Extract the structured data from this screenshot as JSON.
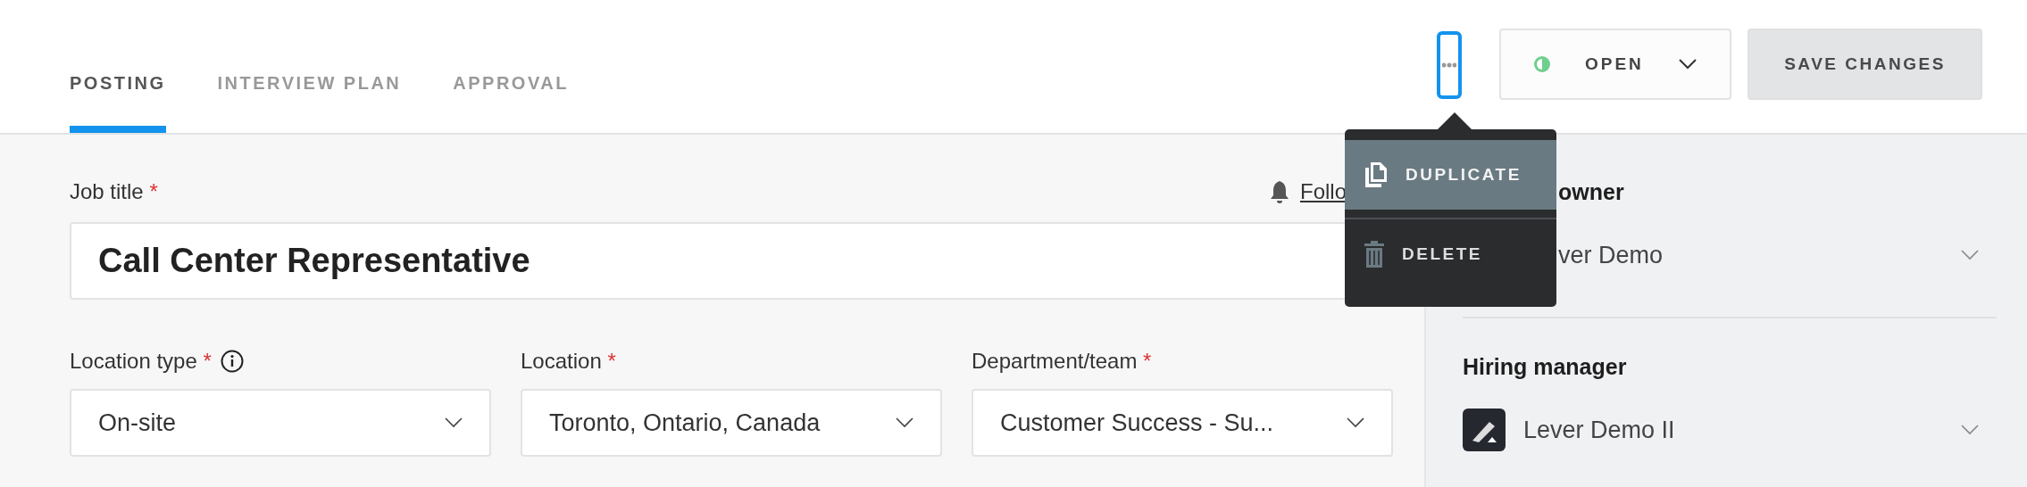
{
  "tabs": [
    {
      "label": "POSTING",
      "selected": true
    },
    {
      "label": "INTERVIEW PLAN",
      "selected": false
    },
    {
      "label": "APPROVAL",
      "selected": false
    }
  ],
  "status_button": {
    "label": "OPEN"
  },
  "save_button": {
    "label": "SAVE CHANGES"
  },
  "menu": {
    "items": [
      {
        "label": "DUPLICATE",
        "kind": "duplicate",
        "selected": true
      },
      {
        "label": "DELETE",
        "kind": "delete",
        "selected": false
      }
    ]
  },
  "form": {
    "job_title": {
      "label": "Job title",
      "required": "*",
      "value": "Call Center Representative"
    },
    "follow_link": "Follo",
    "fields": [
      {
        "label": "Location type",
        "required": "*",
        "info": true,
        "value": "On-site"
      },
      {
        "label": "Location",
        "required": "*",
        "info": false,
        "value": "Toronto, Ontario, Canada"
      },
      {
        "label": "Department/team",
        "required": "*",
        "info": false,
        "value": "Customer Success - Su..."
      }
    ]
  },
  "sidebar": {
    "sections": [
      {
        "label": "owner",
        "value": "ver Demo",
        "avatar": false
      },
      {
        "label": "Hiring manager",
        "value": "Lever Demo II",
        "avatar": true
      }
    ]
  }
}
